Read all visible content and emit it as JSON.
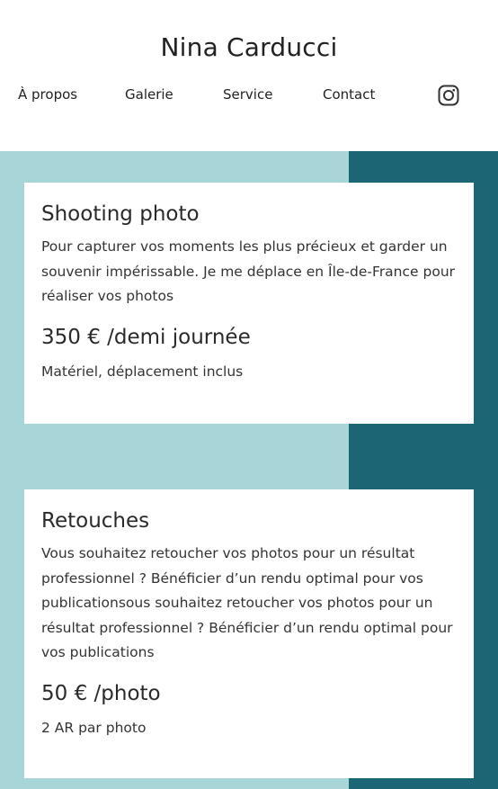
{
  "header": {
    "title": "Nina Carducci",
    "nav": [
      {
        "label": "À propos"
      },
      {
        "label": "Galerie"
      },
      {
        "label": "Service"
      },
      {
        "label": "Contact"
      }
    ],
    "social_icon": "instagram-icon"
  },
  "colors": {
    "light_teal": "#a8d5d8",
    "dark_teal": "#1c6574",
    "card_bg": "#ffffff"
  },
  "services": [
    {
      "title": "Shooting photo",
      "description": "Pour capturer vos moments les plus précieux et garder un souvenir impérissable. Je me déplace en Île-de-France pour réaliser vos photos",
      "price": "350 € /demi journée",
      "note": "Matériel, déplacement inclus"
    },
    {
      "title": "Retouches",
      "description": "Vous souhaitez retoucher vos photos pour un résultat professionnel ? Bénéficier d’un rendu optimal pour vos publicationsous souhaitez retoucher vos photos pour un résultat professionnel ? Bénéficier d’un rendu optimal pour vos publications",
      "price": "50 € /photo",
      "note": "2 AR par photo"
    }
  ]
}
